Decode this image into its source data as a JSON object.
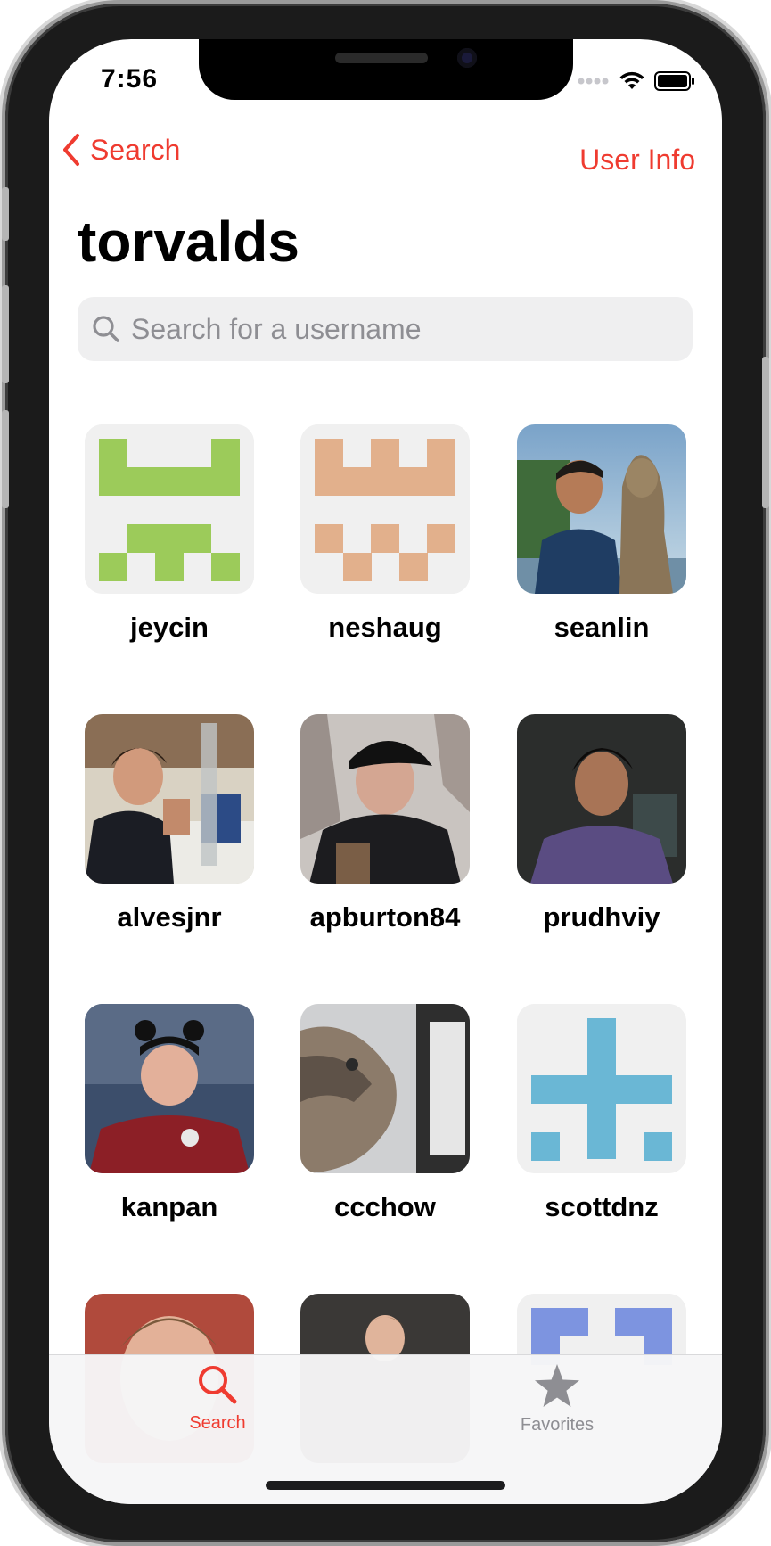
{
  "status_bar": {
    "time": "7:56"
  },
  "nav": {
    "back_label": "Search",
    "right_label": "User Info"
  },
  "title": "torvalds",
  "search": {
    "placeholder": "Search for a username",
    "value": ""
  },
  "followers": [
    {
      "username": "jeycin",
      "avatar_type": "identicon",
      "color": "#9ccb5a"
    },
    {
      "username": "neshaug",
      "avatar_type": "identicon",
      "color": "#e2b08c"
    },
    {
      "username": "seanlin",
      "avatar_type": "photo"
    },
    {
      "username": "alvesjnr",
      "avatar_type": "photo"
    },
    {
      "username": "apburton84",
      "avatar_type": "photo"
    },
    {
      "username": "prudhviy",
      "avatar_type": "photo"
    },
    {
      "username": "kanpan",
      "avatar_type": "photo"
    },
    {
      "username": "ccchow",
      "avatar_type": "photo"
    },
    {
      "username": "scottdnz",
      "avatar_type": "identicon",
      "color": "#6ab7d5"
    }
  ],
  "tab_bar": {
    "tabs": [
      {
        "label": "Search",
        "icon": "magnifier-icon",
        "selected": true
      },
      {
        "label": "Favorites",
        "icon": "star-icon",
        "selected": false
      }
    ]
  },
  "colors": {
    "accent": "#ef3b30",
    "inactive_tab": "#8e8e93"
  }
}
